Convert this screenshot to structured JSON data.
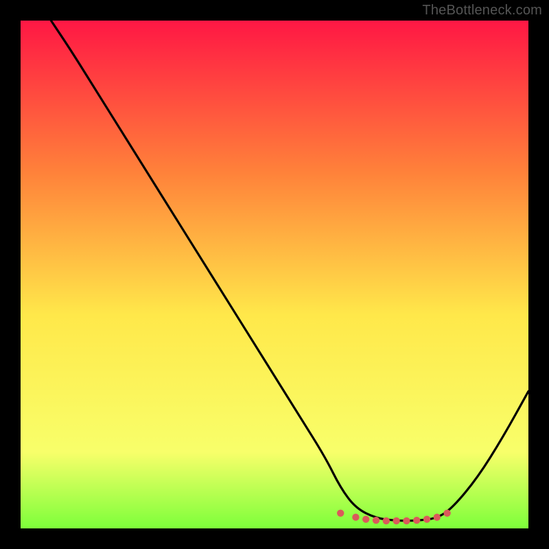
{
  "watermark": "TheBottleneck.com",
  "colors": {
    "bg": "#000000",
    "curve_stroke": "#000000",
    "dot_stroke": "#da5a5a",
    "grad_top": "#ff1744",
    "grad_mid_upper": "#ff823a",
    "grad_mid": "#ffe84a",
    "grad_mid_lower": "#f8ff6a",
    "grad_bottom": "#7dff3a"
  },
  "chart_data": {
    "type": "line",
    "title": "",
    "xlabel": "",
    "ylabel": "",
    "xlim": [
      0,
      100
    ],
    "ylim": [
      0,
      100
    ],
    "series": [
      {
        "name": "bottleneck-curve",
        "x": [
          6,
          10,
          15,
          20,
          25,
          30,
          35,
          40,
          45,
          50,
          55,
          60,
          63,
          66,
          70,
          74,
          78,
          82,
          85,
          90,
          95,
          100
        ],
        "y": [
          100,
          94,
          86,
          78,
          70,
          62,
          54,
          46,
          38,
          30,
          22,
          14,
          8,
          4,
          2,
          1.5,
          1.5,
          2,
          4,
          10,
          18,
          27
        ]
      }
    ],
    "valley_markers": {
      "name": "valley-dots",
      "x": [
        63,
        66,
        68,
        70,
        72,
        74,
        76,
        78,
        80,
        82,
        84
      ],
      "y": [
        3.0,
        2.2,
        1.8,
        1.6,
        1.5,
        1.5,
        1.5,
        1.6,
        1.8,
        2.2,
        3.0
      ]
    }
  }
}
